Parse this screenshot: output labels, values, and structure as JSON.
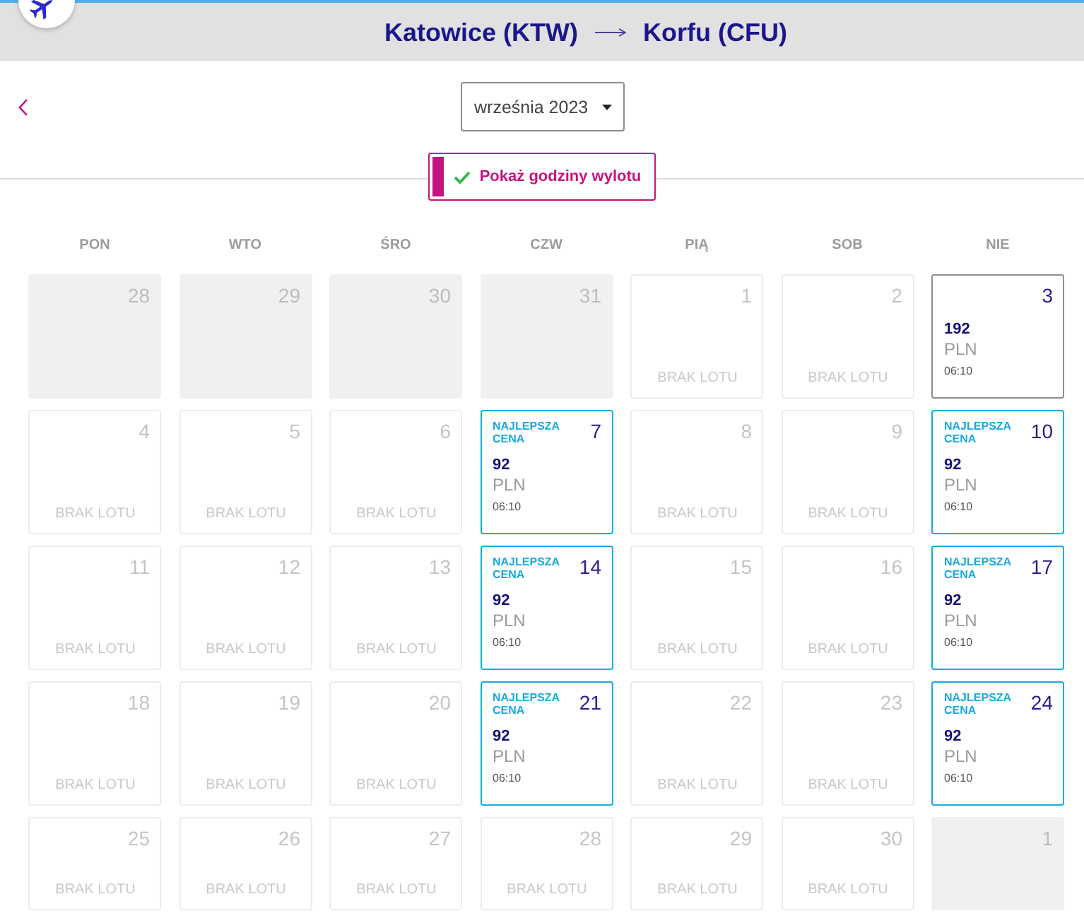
{
  "header": {
    "origin": "Katowice (KTW)",
    "destination": "Korfu (CFU)"
  },
  "month_picker": {
    "value": "września 2023"
  },
  "toggle": {
    "label": "Pokaż godziny wylotu",
    "checked": true
  },
  "weekdays": [
    "PON",
    "WTO",
    "ŚRO",
    "CZW",
    "PIĄ",
    "SOB",
    "NIE"
  ],
  "days": [
    {
      "kind": "outside",
      "day": "28"
    },
    {
      "kind": "outside",
      "day": "29"
    },
    {
      "kind": "outside",
      "day": "30"
    },
    {
      "kind": "outside",
      "day": "31"
    },
    {
      "kind": "no_flight",
      "day": "1",
      "note": "BRAK LOTU"
    },
    {
      "kind": "no_flight",
      "day": "2",
      "note": "BRAK LOTU"
    },
    {
      "kind": "flight",
      "day": "3",
      "best": false,
      "price": "192",
      "currency": "PLN",
      "time": "06:10"
    },
    {
      "kind": "no_flight",
      "day": "4",
      "note": "BRAK LOTU"
    },
    {
      "kind": "no_flight",
      "day": "5",
      "note": "BRAK LOTU"
    },
    {
      "kind": "no_flight",
      "day": "6",
      "note": "BRAK LOTU"
    },
    {
      "kind": "flight",
      "day": "7",
      "best": true,
      "badge": "NAJLEPSZA CENA",
      "price": "92",
      "currency": "PLN",
      "time": "06:10"
    },
    {
      "kind": "no_flight",
      "day": "8",
      "note": "BRAK LOTU"
    },
    {
      "kind": "no_flight",
      "day": "9",
      "note": "BRAK LOTU"
    },
    {
      "kind": "flight",
      "day": "10",
      "best": true,
      "badge": "NAJLEPSZA CENA",
      "price": "92",
      "currency": "PLN",
      "time": "06:10"
    },
    {
      "kind": "no_flight",
      "day": "11",
      "note": "BRAK LOTU"
    },
    {
      "kind": "no_flight",
      "day": "12",
      "note": "BRAK LOTU"
    },
    {
      "kind": "no_flight",
      "day": "13",
      "note": "BRAK LOTU"
    },
    {
      "kind": "flight",
      "day": "14",
      "best": true,
      "badge": "NAJLEPSZA CENA",
      "price": "92",
      "currency": "PLN",
      "time": "06:10"
    },
    {
      "kind": "no_flight",
      "day": "15",
      "note": "BRAK LOTU"
    },
    {
      "kind": "no_flight",
      "day": "16",
      "note": "BRAK LOTU"
    },
    {
      "kind": "flight",
      "day": "17",
      "best": true,
      "badge": "NAJLEPSZA CENA",
      "price": "92",
      "currency": "PLN",
      "time": "06:10"
    },
    {
      "kind": "no_flight",
      "day": "18",
      "note": "BRAK LOTU"
    },
    {
      "kind": "no_flight",
      "day": "19",
      "note": "BRAK LOTU"
    },
    {
      "kind": "no_flight",
      "day": "20",
      "note": "BRAK LOTU"
    },
    {
      "kind": "flight",
      "day": "21",
      "best": true,
      "badge": "NAJLEPSZA CENA",
      "price": "92",
      "currency": "PLN",
      "time": "06:10"
    },
    {
      "kind": "no_flight",
      "day": "22",
      "note": "BRAK LOTU"
    },
    {
      "kind": "no_flight",
      "day": "23",
      "note": "BRAK LOTU"
    },
    {
      "kind": "flight",
      "day": "24",
      "best": true,
      "badge": "NAJLEPSZA CENA",
      "price": "92",
      "currency": "PLN",
      "time": "06:10"
    },
    {
      "kind": "no_flight",
      "day": "25",
      "note": "BRAK LOTU"
    },
    {
      "kind": "no_flight",
      "day": "26",
      "note": "BRAK LOTU"
    },
    {
      "kind": "no_flight",
      "day": "27",
      "note": "BRAK LOTU"
    },
    {
      "kind": "no_flight",
      "day": "28",
      "note": "BRAK LOTU"
    },
    {
      "kind": "no_flight",
      "day": "29",
      "note": "BRAK LOTU"
    },
    {
      "kind": "no_flight",
      "day": "30",
      "note": "BRAK LOTU"
    },
    {
      "kind": "outside",
      "day": "1"
    }
  ]
}
